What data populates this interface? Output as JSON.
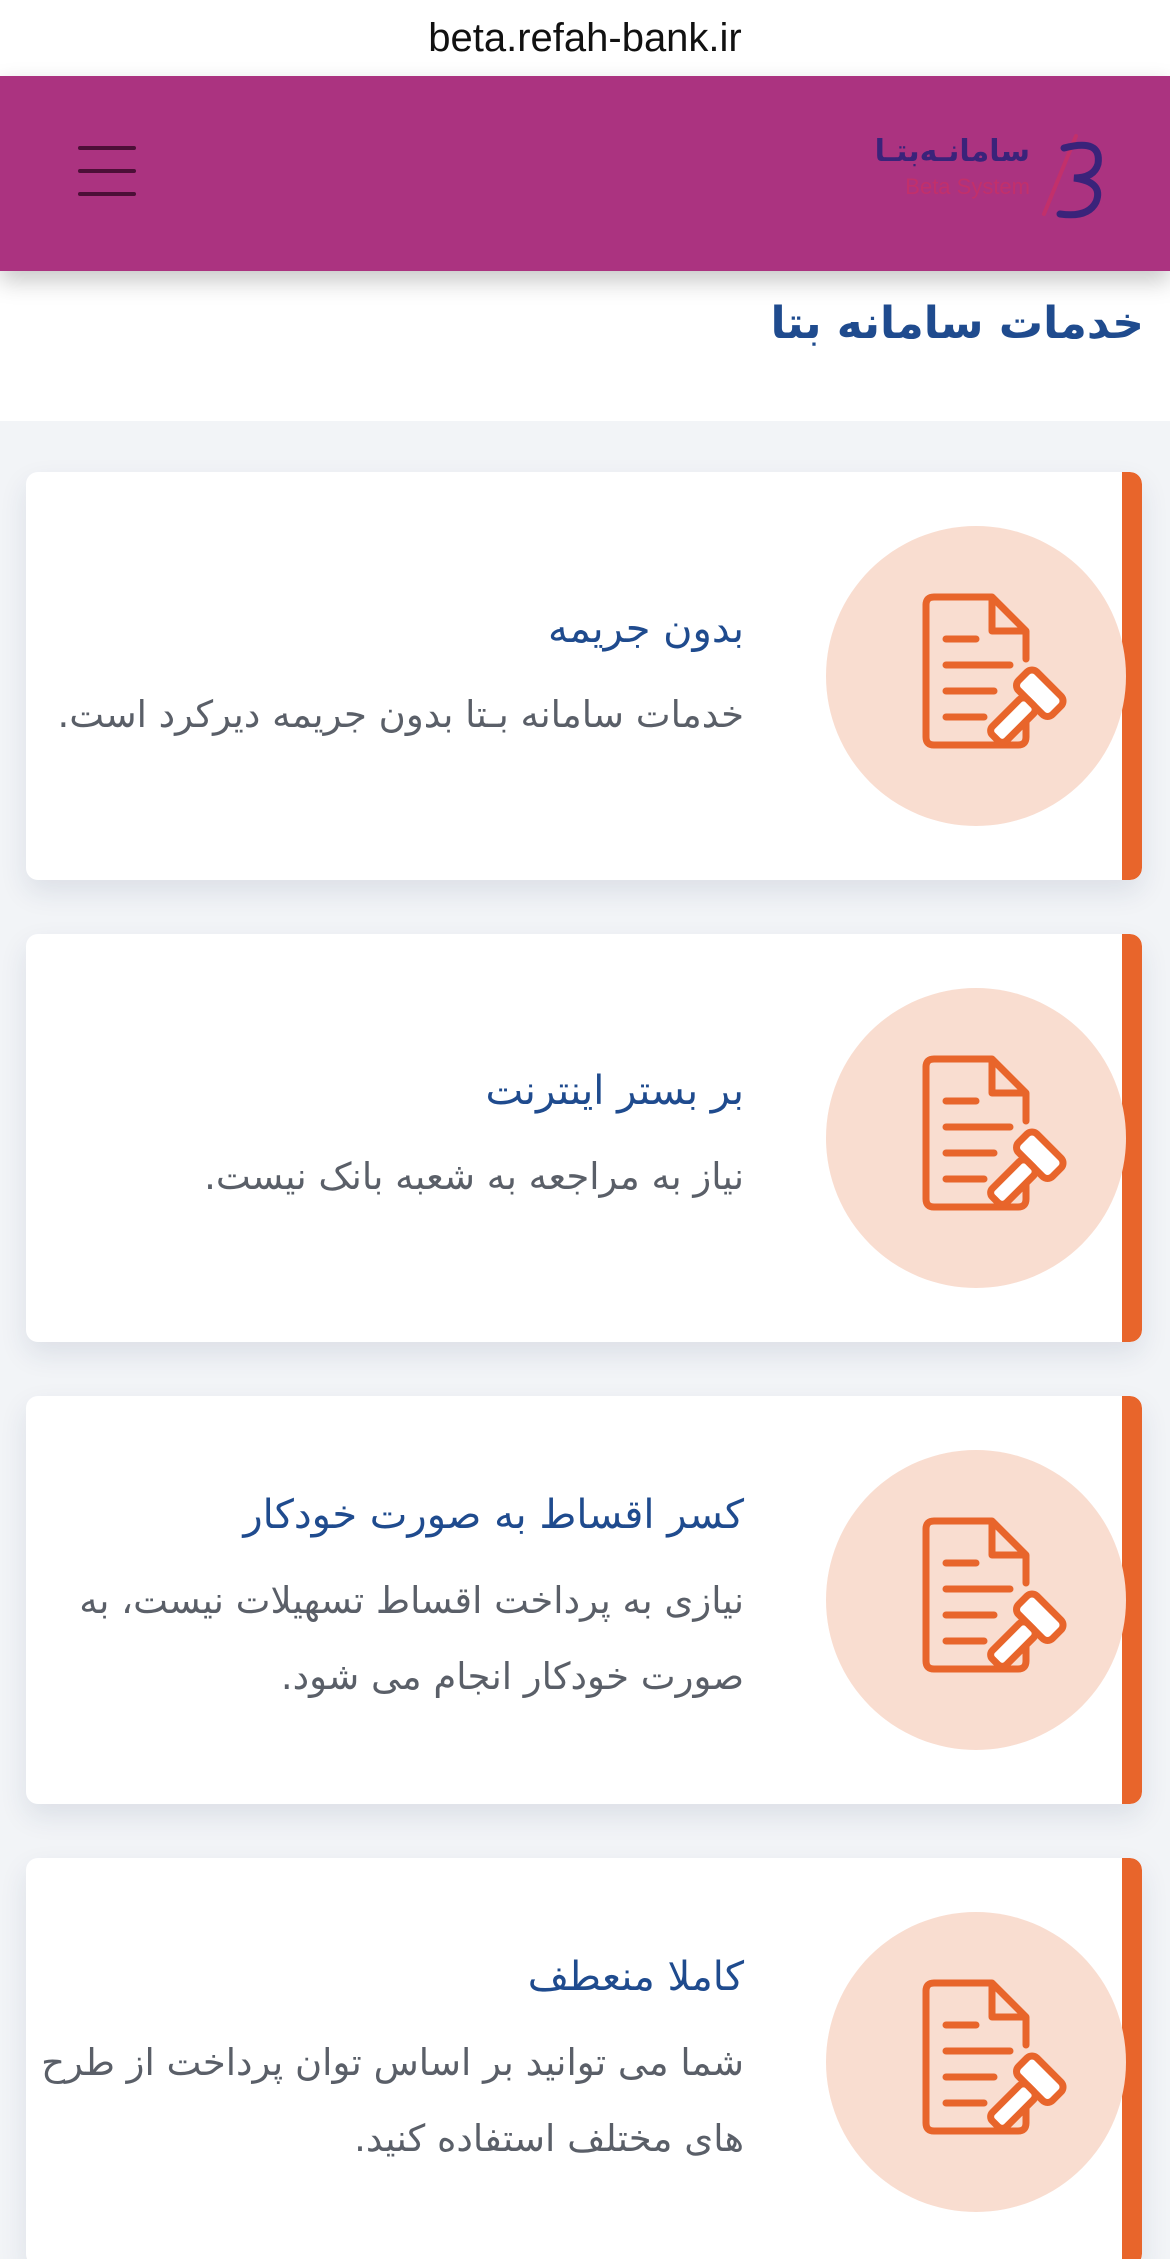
{
  "browser": {
    "url": "beta.refah-bank.ir"
  },
  "header": {
    "logo_fa": "سامانـه‌بتـا",
    "logo_en": "Beta System",
    "menu_icon": "hamburger-menu-icon"
  },
  "section": {
    "title": "خدمات سامانه بتا"
  },
  "colors": {
    "header": "#ab3380",
    "accent": "#e8652b",
    "icon_bg": "#f9ddd0",
    "title_text": "#1f4b8e",
    "body_text": "#5a5f68"
  },
  "cards": [
    {
      "title": "بدون جریمه",
      "desc": "خدمات سامانه بـتا بدون جریمه دیرکرد است.",
      "icon": "document-gavel-icon"
    },
    {
      "title": "بر بستر اینترنت",
      "desc": "نیاز به مراجعه به شعبه بانک نیست.",
      "icon": "document-gavel-icon"
    },
    {
      "title": "کسر اقساط به صورت خودکار",
      "desc": "نیازی به پرداخت اقساط تسهیلات نیست، به صورت خودکار انجام می شود.",
      "icon": "document-gavel-icon"
    },
    {
      "title": "کاملا منعطف",
      "desc": "شما می توانید بر اساس توان پرداخت از طرح های مختلف استفاده کنید.",
      "icon": "document-gavel-icon"
    }
  ]
}
